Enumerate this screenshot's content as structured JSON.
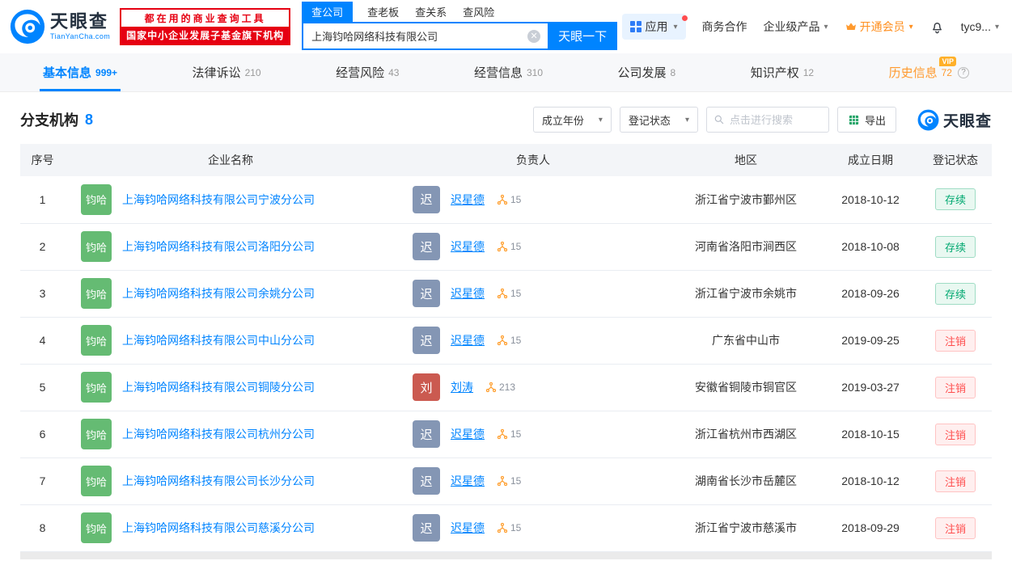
{
  "colors": {
    "accent": "#0084ff",
    "brand_red": "#e60012",
    "vip_orange": "#ff9a2e",
    "status_active_green": "#00a870",
    "status_cancelled_red": "#ff4e4e",
    "company_avatar_green": "#65bb73",
    "person_avatar_blue": "#8496b4",
    "person_avatar_red": "#cb5a50"
  },
  "header": {
    "logo": {
      "title": "天眼查",
      "subtitle": "TianYanCha.com"
    },
    "slogan": {
      "line1": "都在用的商业查询工具",
      "line2": "国家中小企业发展子基金旗下机构"
    },
    "search_tabs": [
      {
        "label": "查公司"
      },
      {
        "label": "查老板"
      },
      {
        "label": "查关系"
      },
      {
        "label": "查风险"
      }
    ],
    "search": {
      "value": "上海钧哈网络科技有限公司",
      "button": "天眼一下"
    },
    "nav": {
      "app": "应用",
      "cooperation": "商务合作",
      "enterprise": "企业级产品",
      "vip": "开通会员",
      "user": "tyc9..."
    }
  },
  "tabs": [
    {
      "label": "基本信息",
      "count": "999+"
    },
    {
      "label": "法律诉讼",
      "count": "210"
    },
    {
      "label": "经营风险",
      "count": "43"
    },
    {
      "label": "经营信息",
      "count": "310"
    },
    {
      "label": "公司发展",
      "count": "8"
    },
    {
      "label": "知识产权",
      "count": "12"
    },
    {
      "label": "历史信息",
      "count": "72",
      "vip_tag": "VIP",
      "help": "?"
    }
  ],
  "section": {
    "title": "分支机构",
    "count": "8",
    "filter_year": "成立年份",
    "filter_status": "登记状态",
    "search_placeholder": "点击进行搜索",
    "export_label": "导出",
    "brand": "天眼查"
  },
  "table": {
    "headers": [
      "序号",
      "企业名称",
      "负责人",
      "地区",
      "成立日期",
      "登记状态"
    ],
    "rows": [
      {
        "idx": "1",
        "company_avatar": "钧哈",
        "company": "上海钧哈网络科技有限公司宁波分公司",
        "person_avatar": "迟",
        "person_avatar_color": "#8496b4",
        "person": "迟星德",
        "links": "15",
        "region": "浙江省宁波市鄞州区",
        "date": "2018-10-12",
        "status": "存续",
        "status_type": "active"
      },
      {
        "idx": "2",
        "company_avatar": "钧哈",
        "company": "上海钧哈网络科技有限公司洛阳分公司",
        "person_avatar": "迟",
        "person_avatar_color": "#8496b4",
        "person": "迟星德",
        "links": "15",
        "region": "河南省洛阳市涧西区",
        "date": "2018-10-08",
        "status": "存续",
        "status_type": "active"
      },
      {
        "idx": "3",
        "company_avatar": "钧哈",
        "company": "上海钧哈网络科技有限公司余姚分公司",
        "person_avatar": "迟",
        "person_avatar_color": "#8496b4",
        "person": "迟星德",
        "links": "15",
        "region": "浙江省宁波市余姚市",
        "date": "2018-09-26",
        "status": "存续",
        "status_type": "active"
      },
      {
        "idx": "4",
        "company_avatar": "钧哈",
        "company": "上海钧哈网络科技有限公司中山分公司",
        "person_avatar": "迟",
        "person_avatar_color": "#8496b4",
        "person": "迟星德",
        "links": "15",
        "region": "广东省中山市",
        "date": "2019-09-25",
        "status": "注销",
        "status_type": "cancelled"
      },
      {
        "idx": "5",
        "company_avatar": "钧哈",
        "company": "上海钧哈网络科技有限公司铜陵分公司",
        "person_avatar": "刘",
        "person_avatar_color": "#cb5a50",
        "person": "刘涛",
        "links": "213",
        "region": "安徽省铜陵市铜官区",
        "date": "2019-03-27",
        "status": "注销",
        "status_type": "cancelled"
      },
      {
        "idx": "6",
        "company_avatar": "钧哈",
        "company": "上海钧哈网络科技有限公司杭州分公司",
        "person_avatar": "迟",
        "person_avatar_color": "#8496b4",
        "person": "迟星德",
        "links": "15",
        "region": "浙江省杭州市西湖区",
        "date": "2018-10-15",
        "status": "注销",
        "status_type": "cancelled"
      },
      {
        "idx": "7",
        "company_avatar": "钧哈",
        "company": "上海钧哈网络科技有限公司长沙分公司",
        "person_avatar": "迟",
        "person_avatar_color": "#8496b4",
        "person": "迟星德",
        "links": "15",
        "region": "湖南省长沙市岳麓区",
        "date": "2018-10-12",
        "status": "注销",
        "status_type": "cancelled"
      },
      {
        "idx": "8",
        "company_avatar": "钧哈",
        "company": "上海钧哈网络科技有限公司慈溪分公司",
        "person_avatar": "迟",
        "person_avatar_color": "#8496b4",
        "person": "迟星德",
        "links": "15",
        "region": "浙江省宁波市慈溪市",
        "date": "2018-09-29",
        "status": "注销",
        "status_type": "cancelled"
      }
    ]
  }
}
